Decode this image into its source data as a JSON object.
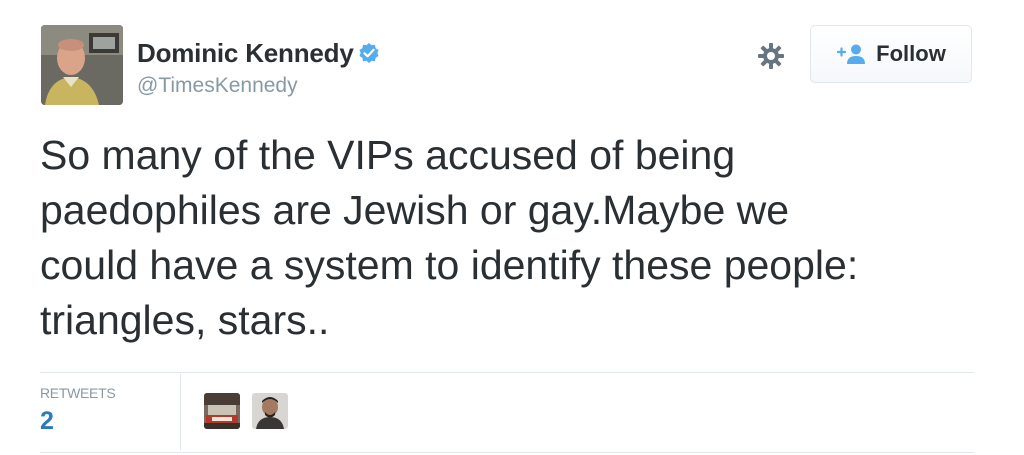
{
  "tweet": {
    "author": {
      "display_name": "Dominic Kennedy",
      "handle": "@TimesKennedy",
      "verified": true
    },
    "text_lines": [
      "So many of the VIPs accused of being",
      "paedophiles are Jewish or gay.Maybe we",
      "could have a system to identify these people:",
      "triangles, stars.."
    ],
    "actions": {
      "follow_label": "Follow",
      "settings_icon": "gear-icon"
    },
    "stats": {
      "retweets_label": "RETWEETS",
      "retweets_count": "2"
    },
    "retweeters": [
      {
        "icon": "retweeter-avatar"
      },
      {
        "icon": "retweeter-avatar"
      }
    ],
    "colors": {
      "accent": "#55acee",
      "link": "#2b7bb9",
      "text": "#292f33",
      "muted": "#8899a6",
      "border": "#e1e8ed"
    }
  }
}
